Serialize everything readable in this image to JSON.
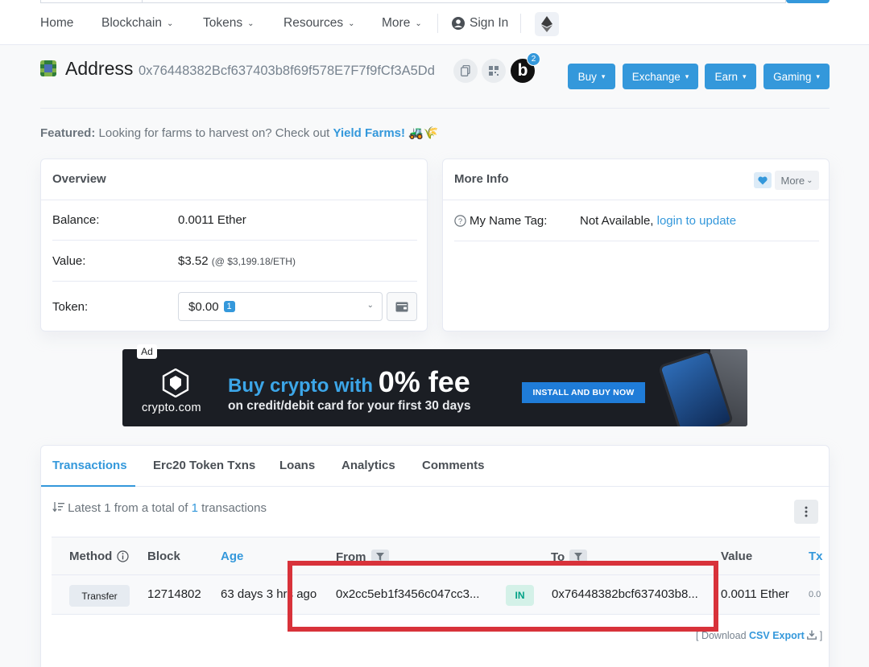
{
  "nav": {
    "items": [
      {
        "label": "Home",
        "has_caret": false
      },
      {
        "label": "Blockchain",
        "has_caret": true
      },
      {
        "label": "Tokens",
        "has_caret": true
      },
      {
        "label": "Resources",
        "has_caret": true
      },
      {
        "label": "More",
        "has_caret": true
      }
    ],
    "sign_in": "Sign In",
    "network_icon": "ethereum-icon"
  },
  "address_header": {
    "title": "Address",
    "hash": "0x76448382Bcf637403b8f69f578E7F7f9fCf3A5Dd",
    "badge_letter": "b",
    "badge_count": "2",
    "actions": [
      "Buy",
      "Exchange",
      "Earn",
      "Gaming"
    ]
  },
  "featured": {
    "label": "Featured:",
    "text": "Looking for farms to harvest on? Check out",
    "link": "Yield Farms!",
    "emoji": "🚜🌾"
  },
  "overview": {
    "title": "Overview",
    "balance_label": "Balance:",
    "balance_value": "0.0011 Ether",
    "value_label": "Value:",
    "value_amount": "$3.52",
    "value_rate": "(@ $3,199.18/ETH)",
    "token_label": "Token:",
    "token_value": "$0.00",
    "token_count": "1"
  },
  "more_info": {
    "title": "More Info",
    "more_button": "More",
    "name_tag_label": "My Name Tag:",
    "name_tag_value": "Not Available,",
    "name_tag_link": "login to update"
  },
  "ad": {
    "tag": "Ad",
    "brand": "crypto.com",
    "headline_prefix": "Buy crypto with",
    "headline_big": "0% fee",
    "subline": "on credit/debit card for your first 30 days",
    "cta": "INSTALL AND BUY NOW"
  },
  "tabs": [
    "Transactions",
    "Erc20 Token Txns",
    "Loans",
    "Analytics",
    "Comments"
  ],
  "active_tab": "Transactions",
  "summary": {
    "prefix": "Latest 1 from a total of",
    "count": "1",
    "suffix": "transactions"
  },
  "table": {
    "headers": {
      "method": "Method",
      "block": "Block",
      "age": "Age",
      "from": "From",
      "to": "To",
      "value": "Value",
      "txn_fee": "Tx"
    },
    "rows": [
      {
        "method": "Transfer",
        "block": "12714802",
        "age": "63 days 3 hrs ago",
        "from": "0x2cc5eb1f3456c047cc3...",
        "direction": "IN",
        "to": "0x76448382bcf637403b8...",
        "value": "0.0011 Ether",
        "fee": "0.0"
      }
    ]
  },
  "csv_export": {
    "open": "[ Download",
    "link": "CSV Export",
    "close": "]"
  },
  "colors": {
    "accent": "#3498db",
    "highlight_box": "#d8323a",
    "in_badge_bg": "#d4f1e8",
    "in_badge_text": "#00a186"
  }
}
